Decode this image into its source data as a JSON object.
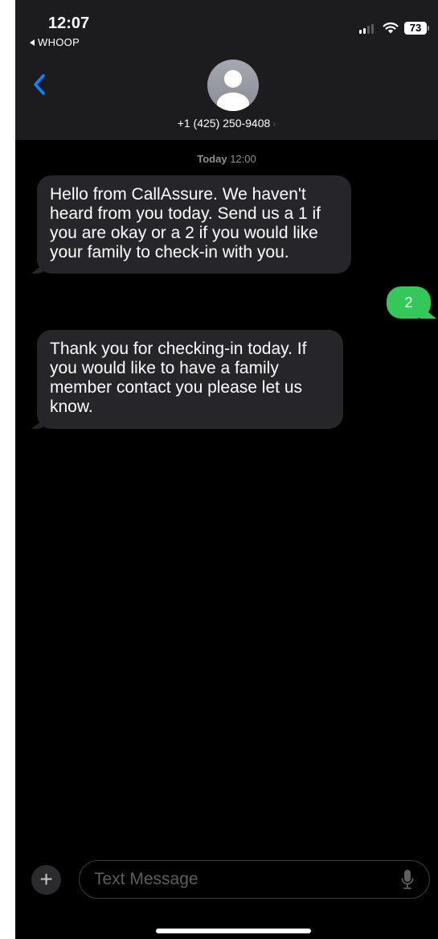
{
  "status_bar": {
    "time": "12:07",
    "back_app": "WHOOP",
    "battery": "73",
    "signal_icon": "cellular-signal-icon",
    "wifi_icon": "wifi-icon"
  },
  "header": {
    "back_icon": "chevron-left-icon",
    "avatar_icon": "person-silhouette-icon",
    "contact": "+1 (425) 250-9408",
    "contact_chevron": "›"
  },
  "timestamp": {
    "day": "Today",
    "time": "12:00"
  },
  "messages": [
    {
      "direction": "incoming",
      "text": "Hello from CallAssure. We haven't heard from you today. Send us a 1 if you are okay or a 2 if you would like your family to check-in with you."
    },
    {
      "direction": "outgoing",
      "text": "2"
    },
    {
      "direction": "incoming",
      "text": "Thank you for checking-in today. If you would like to have a family member contact you please let us know."
    }
  ],
  "composer": {
    "plus_label": "+",
    "placeholder": "Text Message",
    "mic_icon": "microphone-icon"
  },
  "colors": {
    "background": "#000000",
    "header": "#1c1c1e",
    "incoming_bubble": "#26252a",
    "outgoing_bubble": "#34c759",
    "accent": "#0a84ff"
  }
}
